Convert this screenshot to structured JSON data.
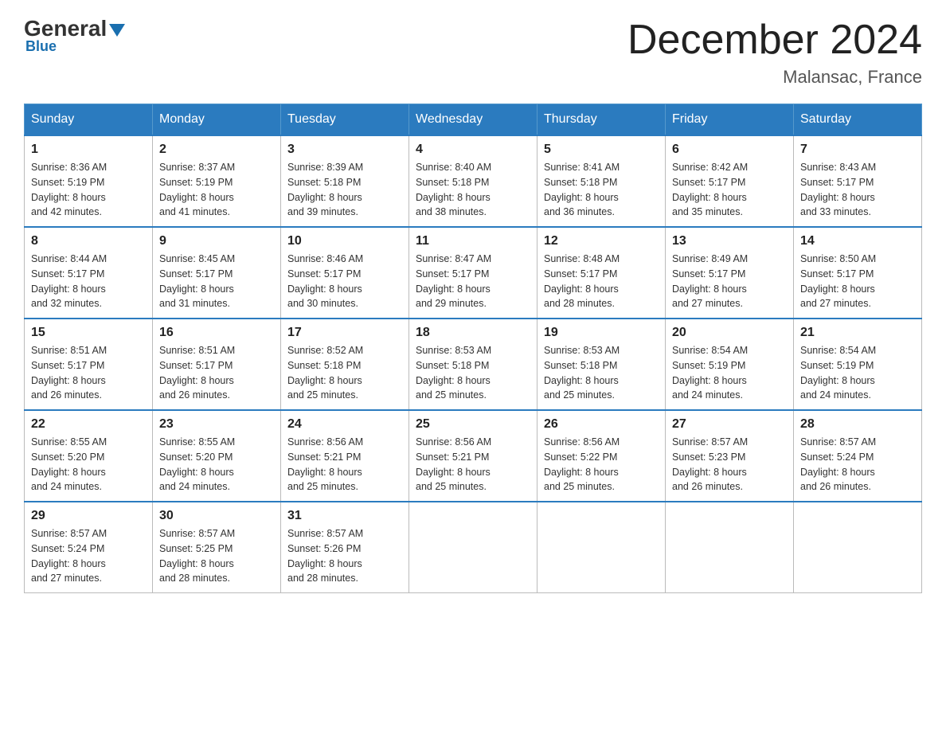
{
  "header": {
    "logo_general": "General",
    "logo_blue": "Blue",
    "month_title": "December 2024",
    "location": "Malansac, France"
  },
  "weekdays": [
    "Sunday",
    "Monday",
    "Tuesday",
    "Wednesday",
    "Thursday",
    "Friday",
    "Saturday"
  ],
  "weeks": [
    [
      {
        "day": "1",
        "sunrise": "8:36 AM",
        "sunset": "5:19 PM",
        "daylight": "8 hours and 42 minutes."
      },
      {
        "day": "2",
        "sunrise": "8:37 AM",
        "sunset": "5:19 PM",
        "daylight": "8 hours and 41 minutes."
      },
      {
        "day": "3",
        "sunrise": "8:39 AM",
        "sunset": "5:18 PM",
        "daylight": "8 hours and 39 minutes."
      },
      {
        "day": "4",
        "sunrise": "8:40 AM",
        "sunset": "5:18 PM",
        "daylight": "8 hours and 38 minutes."
      },
      {
        "day": "5",
        "sunrise": "8:41 AM",
        "sunset": "5:18 PM",
        "daylight": "8 hours and 36 minutes."
      },
      {
        "day": "6",
        "sunrise": "8:42 AM",
        "sunset": "5:17 PM",
        "daylight": "8 hours and 35 minutes."
      },
      {
        "day": "7",
        "sunrise": "8:43 AM",
        "sunset": "5:17 PM",
        "daylight": "8 hours and 33 minutes."
      }
    ],
    [
      {
        "day": "8",
        "sunrise": "8:44 AM",
        "sunset": "5:17 PM",
        "daylight": "8 hours and 32 minutes."
      },
      {
        "day": "9",
        "sunrise": "8:45 AM",
        "sunset": "5:17 PM",
        "daylight": "8 hours and 31 minutes."
      },
      {
        "day": "10",
        "sunrise": "8:46 AM",
        "sunset": "5:17 PM",
        "daylight": "8 hours and 30 minutes."
      },
      {
        "day": "11",
        "sunrise": "8:47 AM",
        "sunset": "5:17 PM",
        "daylight": "8 hours and 29 minutes."
      },
      {
        "day": "12",
        "sunrise": "8:48 AM",
        "sunset": "5:17 PM",
        "daylight": "8 hours and 28 minutes."
      },
      {
        "day": "13",
        "sunrise": "8:49 AM",
        "sunset": "5:17 PM",
        "daylight": "8 hours and 27 minutes."
      },
      {
        "day": "14",
        "sunrise": "8:50 AM",
        "sunset": "5:17 PM",
        "daylight": "8 hours and 27 minutes."
      }
    ],
    [
      {
        "day": "15",
        "sunrise": "8:51 AM",
        "sunset": "5:17 PM",
        "daylight": "8 hours and 26 minutes."
      },
      {
        "day": "16",
        "sunrise": "8:51 AM",
        "sunset": "5:17 PM",
        "daylight": "8 hours and 26 minutes."
      },
      {
        "day": "17",
        "sunrise": "8:52 AM",
        "sunset": "5:18 PM",
        "daylight": "8 hours and 25 minutes."
      },
      {
        "day": "18",
        "sunrise": "8:53 AM",
        "sunset": "5:18 PM",
        "daylight": "8 hours and 25 minutes."
      },
      {
        "day": "19",
        "sunrise": "8:53 AM",
        "sunset": "5:18 PM",
        "daylight": "8 hours and 25 minutes."
      },
      {
        "day": "20",
        "sunrise": "8:54 AM",
        "sunset": "5:19 PM",
        "daylight": "8 hours and 24 minutes."
      },
      {
        "day": "21",
        "sunrise": "8:54 AM",
        "sunset": "5:19 PM",
        "daylight": "8 hours and 24 minutes."
      }
    ],
    [
      {
        "day": "22",
        "sunrise": "8:55 AM",
        "sunset": "5:20 PM",
        "daylight": "8 hours and 24 minutes."
      },
      {
        "day": "23",
        "sunrise": "8:55 AM",
        "sunset": "5:20 PM",
        "daylight": "8 hours and 24 minutes."
      },
      {
        "day": "24",
        "sunrise": "8:56 AM",
        "sunset": "5:21 PM",
        "daylight": "8 hours and 25 minutes."
      },
      {
        "day": "25",
        "sunrise": "8:56 AM",
        "sunset": "5:21 PM",
        "daylight": "8 hours and 25 minutes."
      },
      {
        "day": "26",
        "sunrise": "8:56 AM",
        "sunset": "5:22 PM",
        "daylight": "8 hours and 25 minutes."
      },
      {
        "day": "27",
        "sunrise": "8:57 AM",
        "sunset": "5:23 PM",
        "daylight": "8 hours and 26 minutes."
      },
      {
        "day": "28",
        "sunrise": "8:57 AM",
        "sunset": "5:24 PM",
        "daylight": "8 hours and 26 minutes."
      }
    ],
    [
      {
        "day": "29",
        "sunrise": "8:57 AM",
        "sunset": "5:24 PM",
        "daylight": "8 hours and 27 minutes."
      },
      {
        "day": "30",
        "sunrise": "8:57 AM",
        "sunset": "5:25 PM",
        "daylight": "8 hours and 28 minutes."
      },
      {
        "day": "31",
        "sunrise": "8:57 AM",
        "sunset": "5:26 PM",
        "daylight": "8 hours and 28 minutes."
      },
      null,
      null,
      null,
      null
    ]
  ],
  "labels": {
    "sunrise": "Sunrise:",
    "sunset": "Sunset:",
    "daylight": "Daylight:"
  }
}
